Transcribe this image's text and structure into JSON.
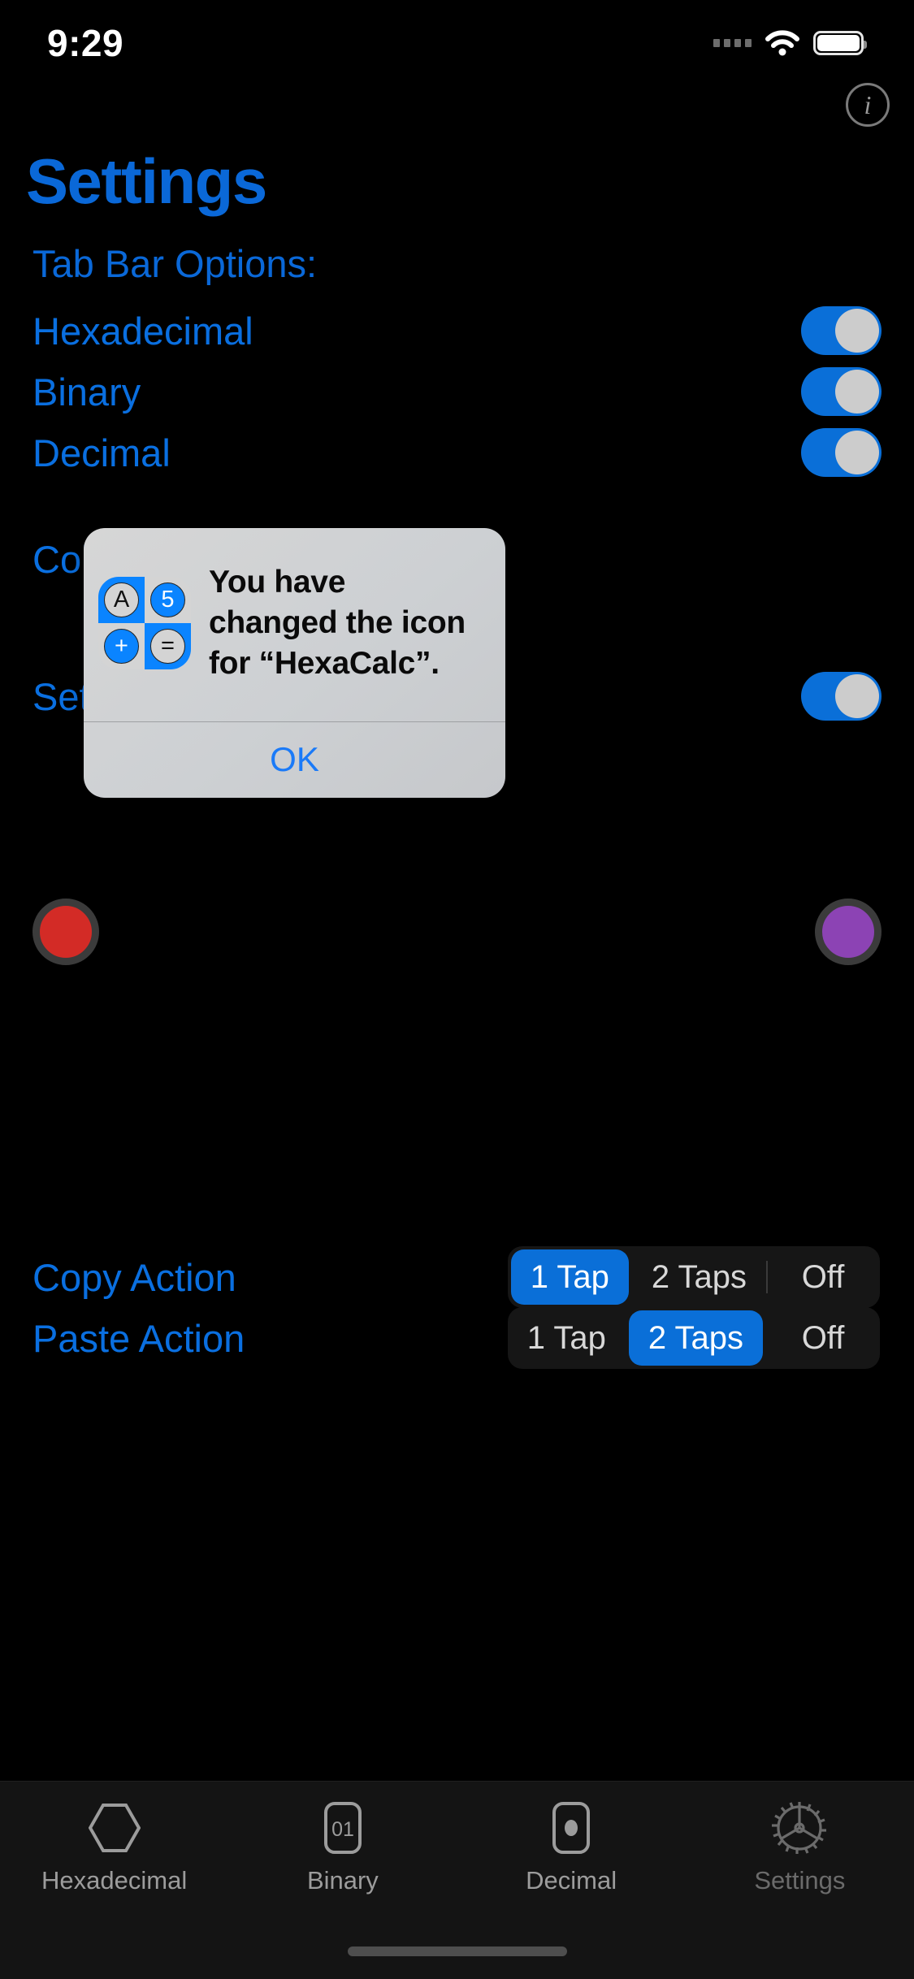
{
  "status_bar": {
    "time": "9:29",
    "signal_icon": "signal-dots-icon",
    "wifi_icon": "wifi-icon",
    "battery_icon": "battery-icon"
  },
  "nav": {
    "info_button_label": "i",
    "info_icon": "info-circle-icon"
  },
  "header": {
    "title": "Settings",
    "accent_color": "#0a68d8"
  },
  "main": {
    "section_label": "Tab Bar Options:",
    "toggle_rows": [
      {
        "label": "Hexadecimal",
        "state": "on"
      },
      {
        "label": "Binary",
        "state": "on"
      },
      {
        "label": "Decimal",
        "state": "on"
      }
    ],
    "color_row": {
      "label": "Color",
      "label_truncated": "Co",
      "swatches": [
        {
          "name": "red-swatch",
          "color": "#d32b26"
        },
        {
          "name": "purple-swatch",
          "color": "#8c43b4"
        }
      ]
    },
    "settings_row": {
      "label_truncated": "Set",
      "state": "on"
    },
    "segmented_rows": [
      {
        "label": "Copy Action",
        "options": [
          "1 Tap",
          "2 Taps",
          "Off"
        ],
        "selected": "1 Tap"
      },
      {
        "label": "Paste Action",
        "options": [
          "1 Tap",
          "2 Taps",
          "Off"
        ],
        "selected": "2 Taps"
      }
    ]
  },
  "alert": {
    "message": "You have changed the icon for “HexaCalc”.",
    "ok_label": "OK",
    "app_icon": {
      "name": "hexacalc-app-icon",
      "tiles": [
        {
          "glyph": "A",
          "tile_bg": "#0a84ff",
          "circle_bg": "#d4d4d4"
        },
        {
          "glyph": "5",
          "tile_bg": "#d4d4d4",
          "circle_bg": "#0a84ff"
        },
        {
          "glyph": "+",
          "tile_bg": "#d4d4d4",
          "circle_bg": "#0a84ff"
        },
        {
          "glyph": "=",
          "tile_bg": "#0a84ff",
          "circle_bg": "#d4d4d4"
        }
      ]
    }
  },
  "tab_bar": {
    "tabs": [
      {
        "label": "Hexadecimal",
        "icon": "hexagon-icon",
        "active": false
      },
      {
        "label": "Binary",
        "icon": "binary-01-icon",
        "active": false
      },
      {
        "label": "Decimal",
        "icon": "decimal-dot-icon",
        "active": false
      },
      {
        "label": "Settings",
        "icon": "gear-icon",
        "active": true
      }
    ]
  }
}
